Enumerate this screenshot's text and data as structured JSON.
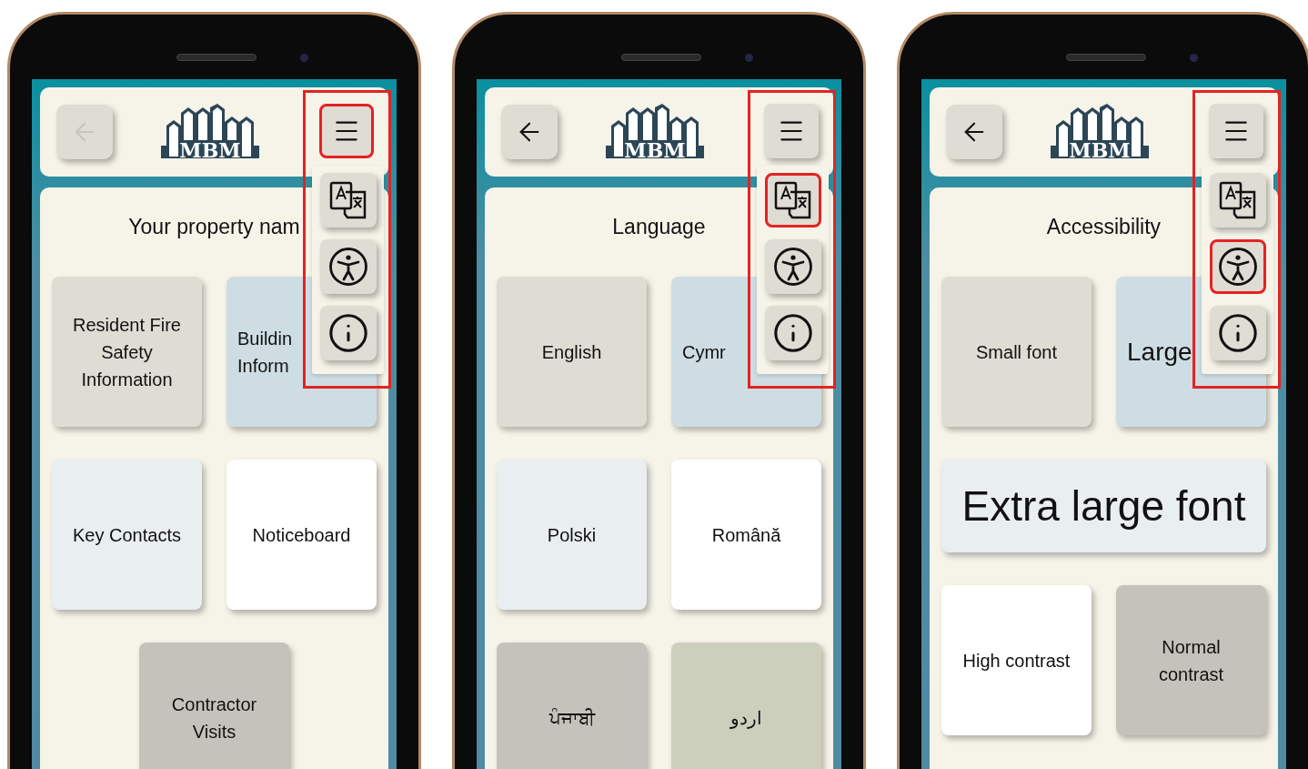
{
  "phones": [
    {
      "header": {
        "back_button": {
          "disabled": true
        },
        "logo": "MBM",
        "menu_button": {
          "highlighted": true
        }
      },
      "title": "Your property nam",
      "tiles": [
        {
          "label": "Resident Fire Safety Information",
          "color": "#dfdcd4",
          "kind": "normal",
          "wide": false,
          "clipped": false
        },
        {
          "label": "Buildin\nInform",
          "color": "#cddde3",
          "kind": "normal",
          "wide": false,
          "clipped": true
        },
        {
          "label": "Key Contacts",
          "color": "#e9eef0",
          "kind": "normal",
          "wide": false,
          "clipped": false
        },
        {
          "label": "Noticeboard",
          "color": "#ffffff",
          "kind": "normal",
          "wide": false,
          "clipped": false
        },
        {
          "label": "Contractor Visits",
          "color": "#c5c2bb",
          "kind": "normal",
          "wide": false,
          "clipped": false
        }
      ],
      "menu": {
        "outlined": true,
        "items": [
          {
            "kind": "language",
            "highlighted": false
          },
          {
            "kind": "accessibility",
            "highlighted": false
          },
          {
            "kind": "info",
            "highlighted": false
          }
        ]
      }
    },
    {
      "header": {
        "back_button": {
          "disabled": false
        },
        "logo": "MBM",
        "menu_button": {
          "highlighted": false
        }
      },
      "title": "Language",
      "tiles": [
        {
          "label": "English",
          "color": "#dfdcd4",
          "kind": "normal",
          "wide": false,
          "clipped": false
        },
        {
          "label": "Cymr",
          "color": "#cddde3",
          "kind": "normal",
          "wide": false,
          "clipped": true
        },
        {
          "label": "Polski",
          "color": "#e9eef0",
          "kind": "normal",
          "wide": false,
          "clipped": false
        },
        {
          "label": "Română",
          "color": "#ffffff",
          "kind": "normal",
          "wide": false,
          "clipped": false
        },
        {
          "label": "ਪੰਜਾਬੀ",
          "color": "#c5c2bb",
          "kind": "normal",
          "wide": false,
          "clipped": false
        },
        {
          "label": "اردو",
          "color": "#cdcfbd",
          "kind": "normal",
          "wide": false,
          "clipped": false
        }
      ],
      "menu": {
        "outlined": true,
        "items": [
          {
            "kind": "language",
            "highlighted": true
          },
          {
            "kind": "accessibility",
            "highlighted": false
          },
          {
            "kind": "info",
            "highlighted": false
          }
        ]
      }
    },
    {
      "header": {
        "back_button": {
          "disabled": false
        },
        "logo": "MBM",
        "menu_button": {
          "highlighted": false
        }
      },
      "title": "Accessibility",
      "tiles": [
        {
          "label": "Small font",
          "color": "#dfdcd4",
          "kind": "normal",
          "wide": false,
          "clipped": false
        },
        {
          "label": "Large",
          "color": "#cddde3",
          "kind": "large",
          "wide": false,
          "clipped": true
        },
        {
          "label": "Extra large font",
          "color": "#e9eef0",
          "kind": "xlarge",
          "wide": true,
          "clipped": false
        },
        {
          "label": "High contrast",
          "color": "#ffffff",
          "kind": "normal",
          "wide": false,
          "clipped": false
        },
        {
          "label": "Normal contrast",
          "color": "#c5c2bb",
          "kind": "normal",
          "wide": false,
          "clipped": false
        }
      ],
      "menu": {
        "outlined": true,
        "items": [
          {
            "kind": "language",
            "highlighted": false
          },
          {
            "kind": "accessibility",
            "highlighted": true
          },
          {
            "kind": "info",
            "highlighted": false
          }
        ]
      }
    }
  ]
}
